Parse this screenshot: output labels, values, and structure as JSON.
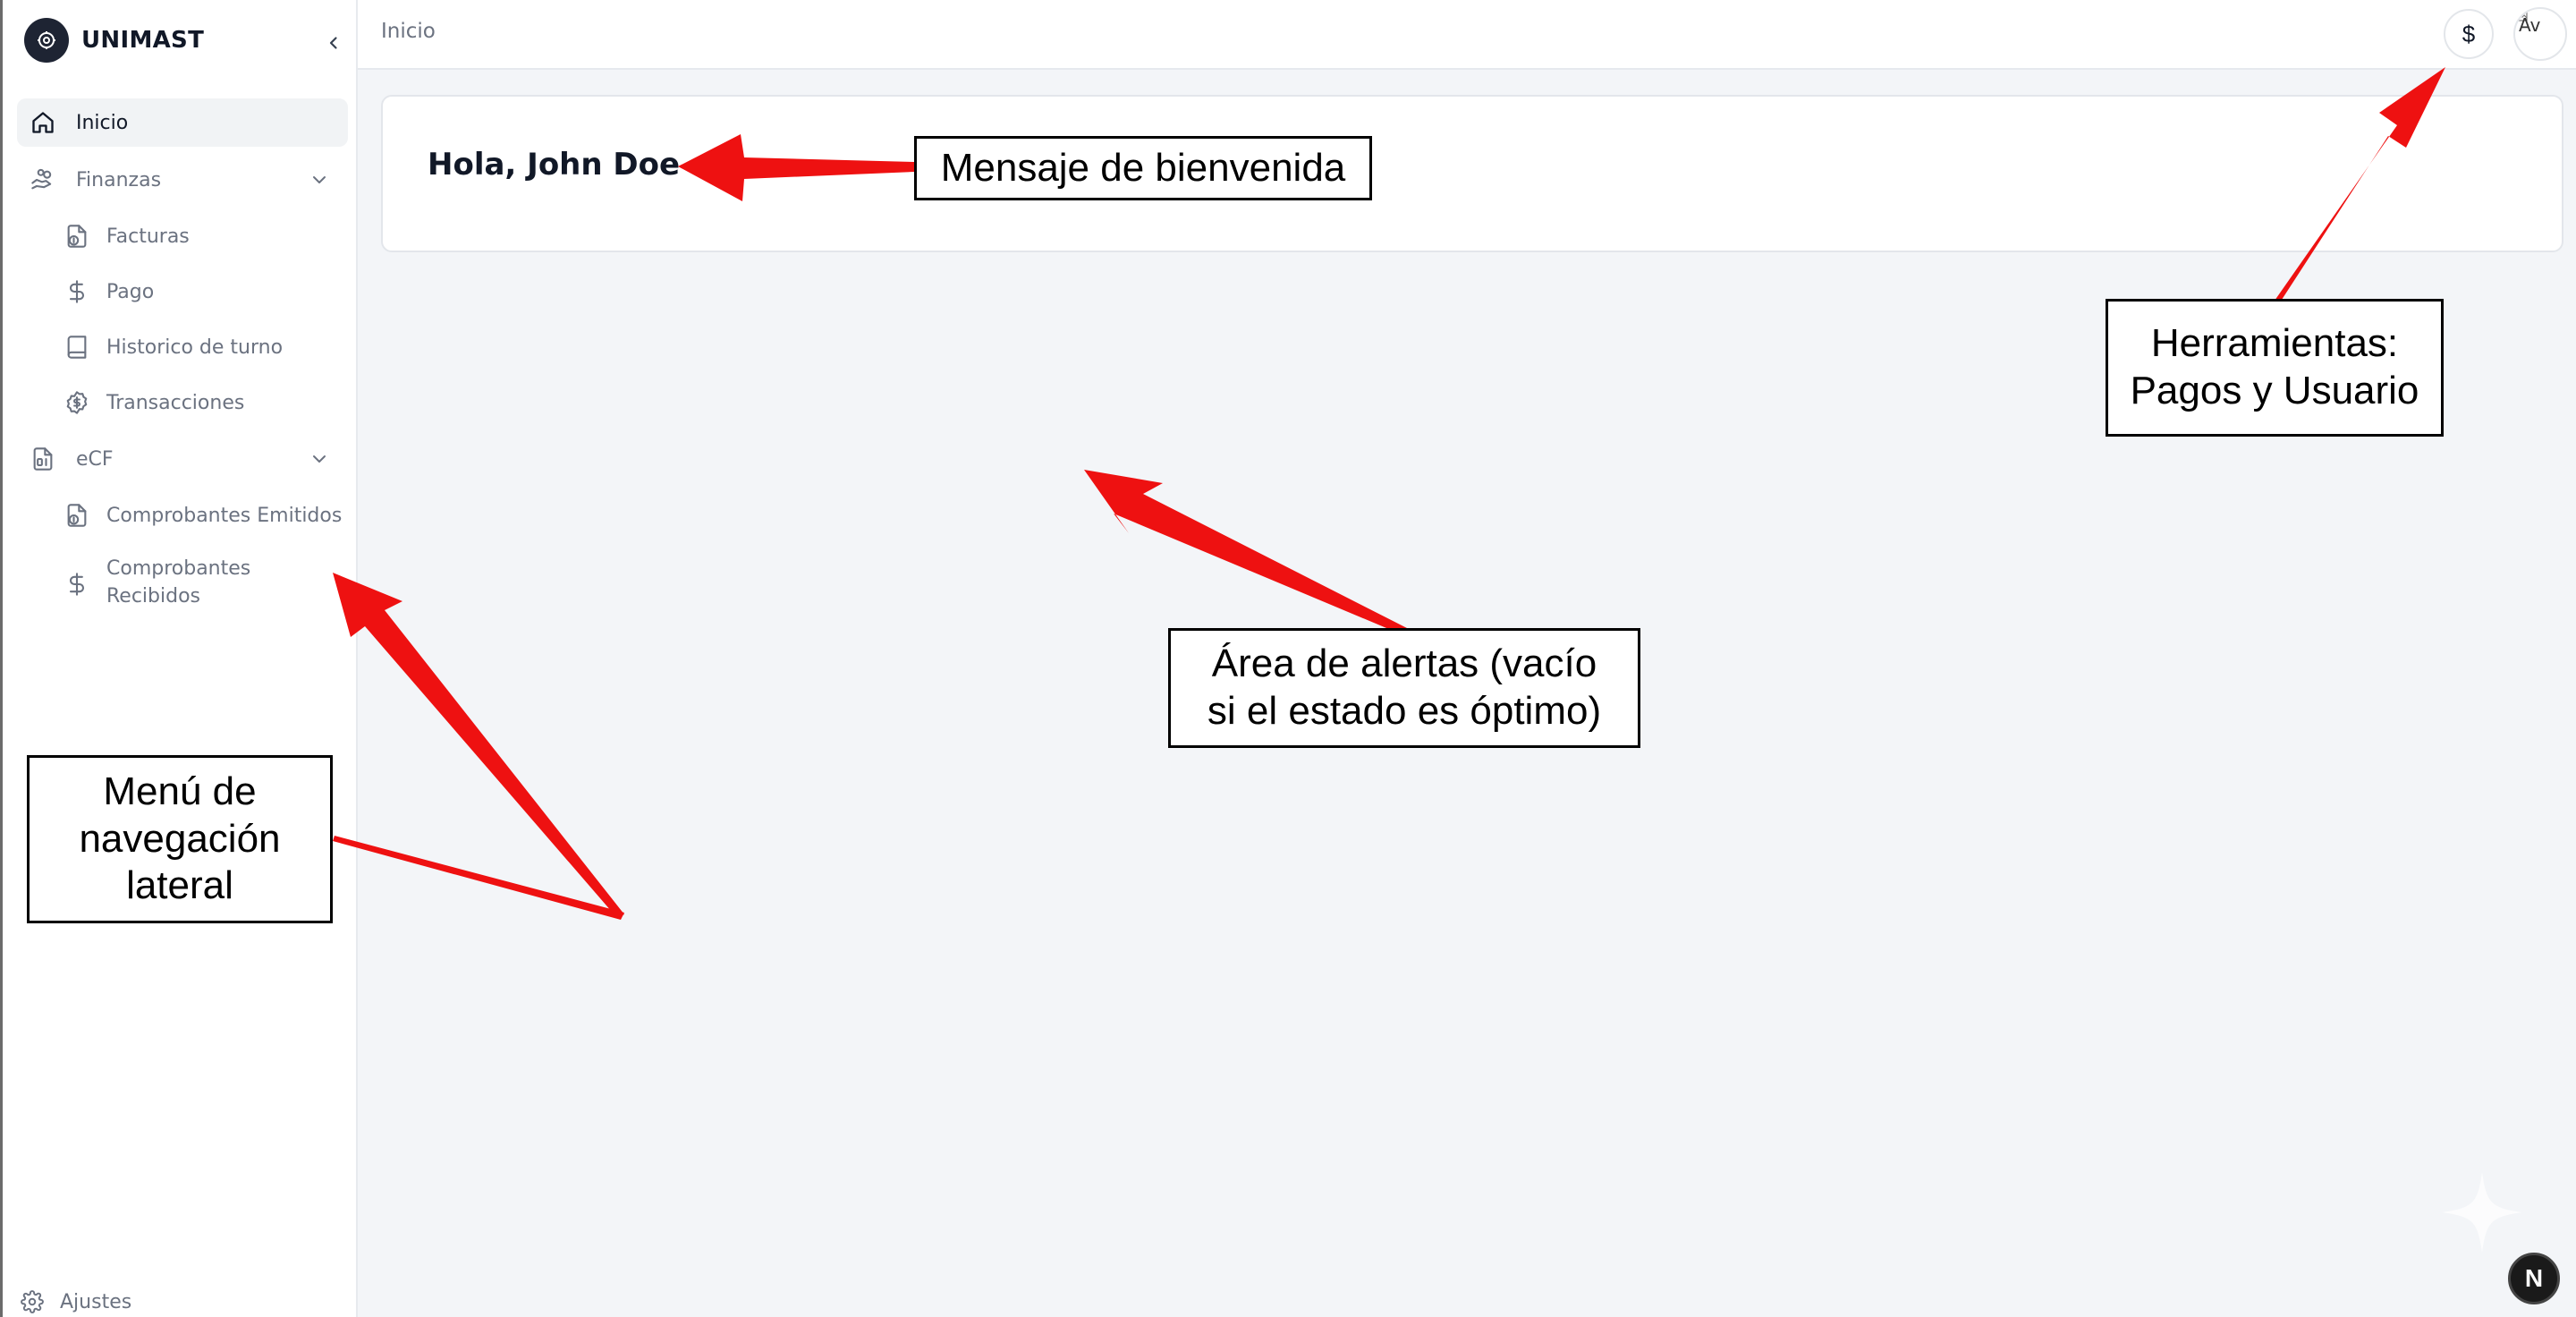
{
  "brand": {
    "name": "UNIMAST",
    "logo_icon": "gear-icon"
  },
  "sidebar": {
    "items": [
      {
        "label": "Inicio",
        "icon": "home-icon",
        "active": true
      },
      {
        "label": "Finanzas",
        "icon": "hand-coins-icon",
        "expanded": true
      },
      {
        "label": "Facturas",
        "icon": "file-dollar-icon"
      },
      {
        "label": "Pago",
        "icon": "dollar-icon"
      },
      {
        "label": "Historico de turno",
        "icon": "book-icon"
      },
      {
        "label": "Transacciones",
        "icon": "badge-dollar-icon"
      },
      {
        "label": "eCF",
        "icon": "file-digit-icon",
        "expanded": true
      },
      {
        "label": "Comprobantes Emitidos",
        "icon": "file-dollar-icon"
      },
      {
        "label": "Comprobantes\nRecibidos",
        "icon": "dollar-icon"
      }
    ],
    "settings_label": "Ajustes"
  },
  "header": {
    "breadcrumb": "Inicio",
    "pay_symbol": "$",
    "avatar_alt": "Av"
  },
  "main": {
    "welcome": "Hola, John Doe"
  },
  "annotations": {
    "welcome": "Mensaje de bienvenida",
    "tools": "Herramientas:\nPagos y Usuario",
    "alerts": "Área de alertas (vacío\nsi el estado es óptimo)",
    "nav": "Menú de\nnavegación\nlateral"
  },
  "colors": {
    "arrow": "#ee1111",
    "sidebar_bg": "#ffffff",
    "page_bg": "#f3f5f8",
    "logo_bg": "#1e2433"
  },
  "nextjs_badge": "N"
}
